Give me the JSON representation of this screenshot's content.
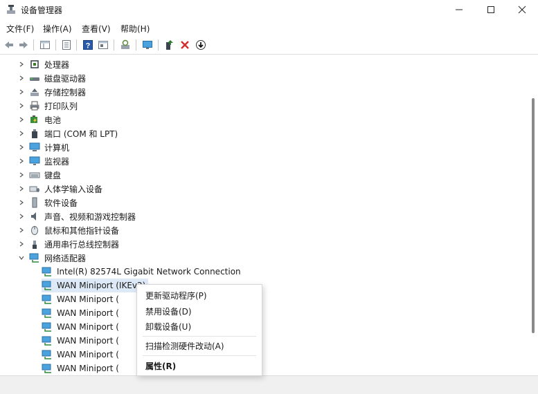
{
  "window": {
    "title": "设备管理器",
    "app_icon": "device-manager-icon"
  },
  "menu": [
    "文件(F)",
    "操作(A)",
    "查看(V)",
    "帮助(H)"
  ],
  "toolbar": {
    "icons": [
      "back-arrow-icon",
      "forward-arrow-icon",
      "properties-pane-icon",
      "list-view-icon",
      "help-icon",
      "console-tree-icon",
      "scan-hardware-icon",
      "monitor-icon",
      "update-driver-icon",
      "uninstall-x-icon",
      "download-arrow-icon"
    ]
  },
  "tree": {
    "categories": [
      {
        "label": "处理器",
        "icon": "processor-icon",
        "expanded": false
      },
      {
        "label": "磁盘驱动器",
        "icon": "disk-drive-icon",
        "expanded": false
      },
      {
        "label": "存储控制器",
        "icon": "storage-controller-icon",
        "expanded": false
      },
      {
        "label": "打印队列",
        "icon": "printer-icon",
        "expanded": false
      },
      {
        "label": "电池",
        "icon": "battery-icon",
        "expanded": false
      },
      {
        "label": "端口 (COM 和 LPT)",
        "icon": "port-icon",
        "expanded": false
      },
      {
        "label": "计算机",
        "icon": "computer-icon",
        "expanded": false
      },
      {
        "label": "监视器",
        "icon": "monitor-icon",
        "expanded": false
      },
      {
        "label": "键盘",
        "icon": "keyboard-icon",
        "expanded": false
      },
      {
        "label": "人体学输入设备",
        "icon": "hid-icon",
        "expanded": false
      },
      {
        "label": "软件设备",
        "icon": "software-device-icon",
        "expanded": false
      },
      {
        "label": "声音、视频和游戏控制器",
        "icon": "speaker-icon",
        "expanded": false
      },
      {
        "label": "鼠标和其他指针设备",
        "icon": "mouse-icon",
        "expanded": false
      },
      {
        "label": "通用串行总线控制器",
        "icon": "usb-icon",
        "expanded": false
      },
      {
        "label": "网络适配器",
        "icon": "network-adapter-icon",
        "expanded": true
      }
    ],
    "network_children": [
      {
        "label": "Intel(R) 82574L Gigabit Network Connection",
        "selected": false
      },
      {
        "label": "WAN Miniport (IKEv2)",
        "selected": true
      },
      {
        "label": "WAN Miniport (",
        "selected": false
      },
      {
        "label": "WAN Miniport (",
        "selected": false
      },
      {
        "label": "WAN Miniport (",
        "selected": false
      },
      {
        "label": "WAN Miniport (",
        "selected": false
      },
      {
        "label": "WAN Miniport (",
        "selected": false
      },
      {
        "label": "WAN Miniport (",
        "selected": false
      }
    ]
  },
  "context_menu": {
    "items": [
      "更新驱动程序(P)",
      "禁用设备(D)",
      "卸载设备(U)",
      "扫描检测硬件改动(A)",
      "属性(R)"
    ]
  },
  "colors": {
    "accent": "#0067c0",
    "selection": "#dde9f7",
    "uninstall_red": "#d32f2f",
    "update_green": "#2e7d32"
  }
}
